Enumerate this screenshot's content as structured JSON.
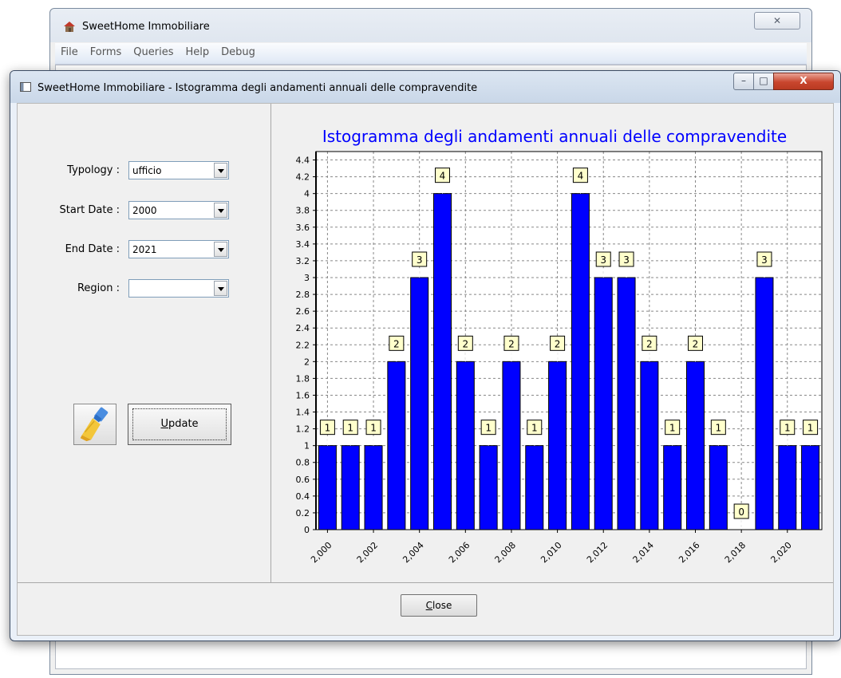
{
  "main_window": {
    "title": "SweetHome Immobiliare",
    "close_glyph": "✕",
    "menu": [
      "File",
      "Forms",
      "Queries",
      "Help",
      "Debug"
    ]
  },
  "dialog": {
    "title": "SweetHome Immobiliare - Istogramma degli andamenti annuali delle compravendite",
    "minimize_glyph": "–",
    "maximize_glyph": "□",
    "close_glyph": "X"
  },
  "form": {
    "typology": {
      "label": "Typology :",
      "value": "ufficio"
    },
    "start_date": {
      "label": "Start Date :",
      "value": "2000"
    },
    "end_date": {
      "label": "End Date :",
      "value": "2021"
    },
    "region": {
      "label": "Region :",
      "value": ""
    },
    "clear_icon": "broom-icon",
    "update_mnemonic": "U",
    "update_rest": "pdate"
  },
  "footer": {
    "close_mnemonic": "C",
    "close_rest": "lose"
  },
  "colors": {
    "bar_fill": "#0000ff",
    "title": "#0000ff",
    "label_bg": "#ffffcc"
  },
  "chart_data": {
    "type": "bar",
    "title": "Istogramma degli andamenti annuali delle compravendite",
    "xlabel": "",
    "ylabel": "",
    "categories": [
      "2,000",
      "2,001",
      "2,002",
      "2,003",
      "2,004",
      "2,005",
      "2,006",
      "2,007",
      "2,008",
      "2,009",
      "2,010",
      "2,011",
      "2,012",
      "2,013",
      "2,014",
      "2,015",
      "2,016",
      "2,017",
      "2,018",
      "2,019",
      "2,020",
      "2,021"
    ],
    "values": [
      1,
      1,
      1,
      2,
      3,
      4,
      2,
      1,
      2,
      1,
      2,
      4,
      3,
      3,
      2,
      1,
      2,
      1,
      0,
      3,
      1,
      1
    ],
    "x_tick_labels": [
      "2,000",
      "2,002",
      "2,004",
      "2,006",
      "2,008",
      "2,010",
      "2,012",
      "2,014",
      "2,016",
      "2,018",
      "2,020"
    ],
    "y_ticks": [
      "0",
      "0.2",
      "0.4",
      "0.6",
      "0.8",
      "1",
      "1.2",
      "1.4",
      "1.6",
      "1.8",
      "2",
      "2.2",
      "2.4",
      "2.6",
      "2.8",
      "3",
      "3.2",
      "3.4",
      "3.6",
      "3.8",
      "4",
      "4.2",
      "4.4"
    ],
    "ylim": [
      0,
      4.5
    ],
    "grid": true,
    "data_labels": true
  }
}
